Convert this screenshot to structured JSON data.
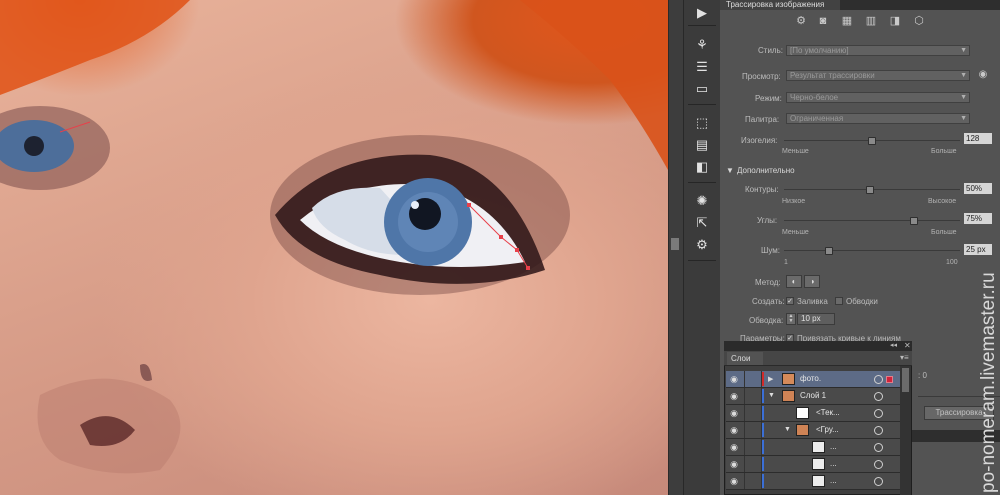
{
  "panel": {
    "title": "Трассировка изображения",
    "style_label": "Стиль:",
    "style_value": "[По умолчанию]",
    "view_label": "Просмотр:",
    "view_value": "Результат трассировки",
    "mode_label": "Режим:",
    "mode_value": "Черно-белое",
    "palette_label": "Палитра:",
    "palette_value": "Ограниченная",
    "threshold_label": "Изогелия:",
    "threshold_value": "128",
    "threshold_min": "Меньше",
    "threshold_max": "Больше",
    "threshold_level": 0.5,
    "advanced_label": "Дополнительно",
    "paths_label": "Контуры:",
    "paths_value": "50%",
    "paths_min": "Низкое",
    "paths_max": "Высокое",
    "paths_level": 0.5,
    "corners_label": "Углы:",
    "corners_value": "75%",
    "corners_min": "Меньше",
    "corners_max": "Больше",
    "corners_level": 0.75,
    "noise_label": "Шум:",
    "noise_value": "25 px",
    "noise_min": "1",
    "noise_max": "100",
    "noise_level": 0.25,
    "method_label": "Метод:",
    "create_label": "Создать:",
    "fill_label": "Заливка",
    "stroke_label": "Обводки",
    "stroke_width_label": "Обводка:",
    "stroke_width_value": "10 px",
    "options_label": "Параметры:",
    "snap_label": "Привязать кривые к линиям",
    "partial_text": ": 0",
    "trace_button": "Трассировка"
  },
  "layers": {
    "tab": "Слои",
    "rows": [
      {
        "name": "фото.",
        "selected": true
      },
      {
        "name": "Слой 1",
        "selected": false
      },
      {
        "name": "<Тек...",
        "selected": false
      },
      {
        "name": "<Гру...",
        "selected": false
      },
      {
        "name": "...",
        "selected": false
      },
      {
        "name": "...",
        "selected": false
      },
      {
        "name": "...",
        "selected": false
      }
    ]
  },
  "watermark": "po-nomeram.livemaster.ru",
  "icons": {
    "toolbar": [
      "play-icon",
      "spray-icon",
      "menu-lines-icon",
      "gradient-icon",
      "transform-icon",
      "align-icon",
      "pathfinder-icon",
      "appearance-icon",
      "export-icon",
      "symbol-icon"
    ],
    "presets": [
      "auto-color-icon",
      "high-color-icon",
      "low-color-icon",
      "grayscale-icon",
      "black-white-icon",
      "outline-icon"
    ]
  },
  "colors": {
    "selection_path": "#e8404a",
    "layer_color_bar": "#d12a2a",
    "layer_color_bar_2": "#3b6fd6"
  }
}
